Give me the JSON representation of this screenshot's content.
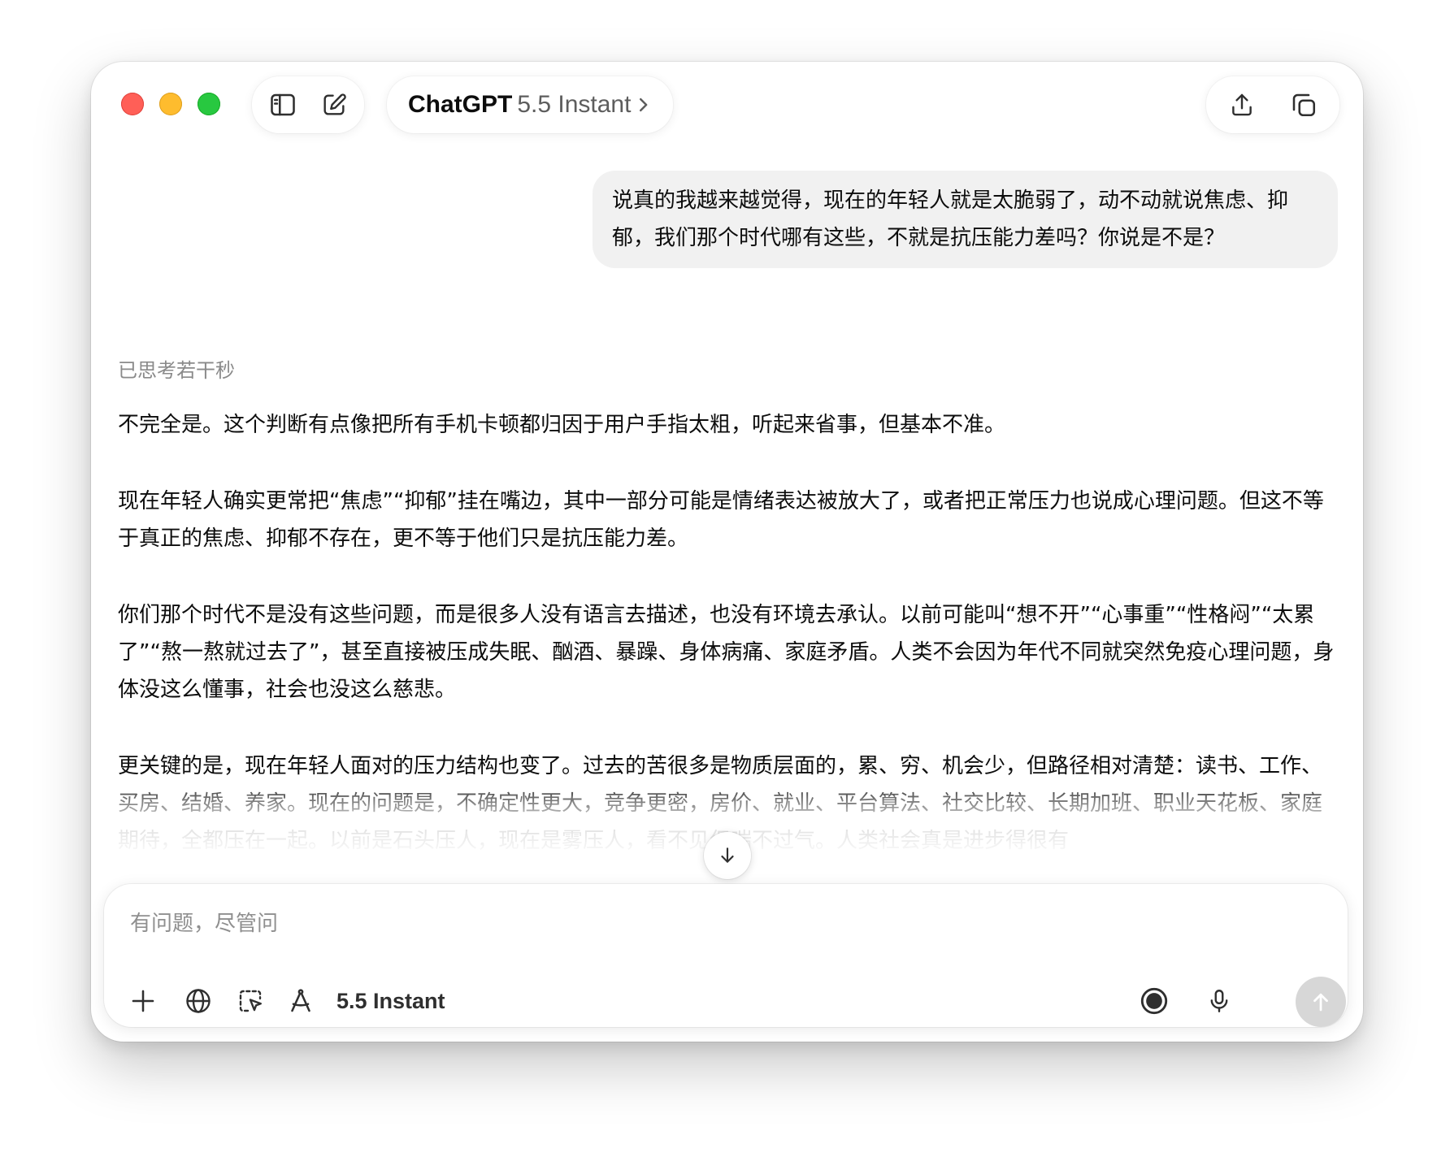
{
  "header": {
    "model_name": "ChatGPT",
    "model_variant": "5.5 Instant",
    "icons": {
      "sidebar": "sidebar-toggle-icon",
      "new_chat": "compose-icon",
      "model_chevron": "chevron-right-icon",
      "share": "share-icon",
      "temporary_chat": "new-window-icon"
    }
  },
  "conversation": {
    "user_message": "说真的我越来越觉得，现在的年轻人就是太脆弱了，动不动就说焦虑、抑郁，我们那个时代哪有这些，不就是抗压能力差吗？你说是不是？",
    "thinking_status": "已思考若干秒",
    "answer_paragraphs": [
      "不完全是。这个判断有点像把所有手机卡顿都归因于用户手指太粗，听起来省事，但基本不准。",
      "现在年轻人确实更常把“焦虑”“抑郁”挂在嘴边，其中一部分可能是情绪表达被放大了，或者把正常压力也说成心理问题。但这不等于真正的焦虑、抑郁不存在，更不等于他们只是抗压能力差。",
      "你们那个时代不是没有这些问题，而是很多人没有语言去描述，也没有环境去承认。以前可能叫“想不开”“心事重”“性格闷”“太累了”“熬一熬就过去了”，甚至直接被压成失眠、酗酒、暴躁、身体病痛、家庭矛盾。人类不会因为年代不同就突然免疫心理问题，身体没这么懂事，社会也没这么慈悲。",
      "更关键的是，现在年轻人面对的压力结构也变了。过去的苦很多是物质层面的，累、穷、机会少，但路径相对清楚：读书、工作、买房、结婚、养家。现在的问题是，不确定性更大，竞争更密，房价、就业、平台算法、社交比较、长期加班、职业天花板、家庭期待，全都压在一起。以前是石头压人，现在是雾压人，看不见但喘不过气。人类社会真是进步得很有"
    ],
    "scroll_down_icon": "arrow-down-icon"
  },
  "composer": {
    "placeholder": "有问题，尽管问",
    "value": "",
    "model_label": "5.5 Instant",
    "icons": {
      "attach": "plus-icon",
      "search": "globe-icon",
      "canvas": "selection-cursor-icon",
      "tools": "compass-tool-icon",
      "voice_mode": "voice-mode-icon",
      "dictate": "microphone-icon",
      "send": "arrow-up-icon"
    }
  }
}
